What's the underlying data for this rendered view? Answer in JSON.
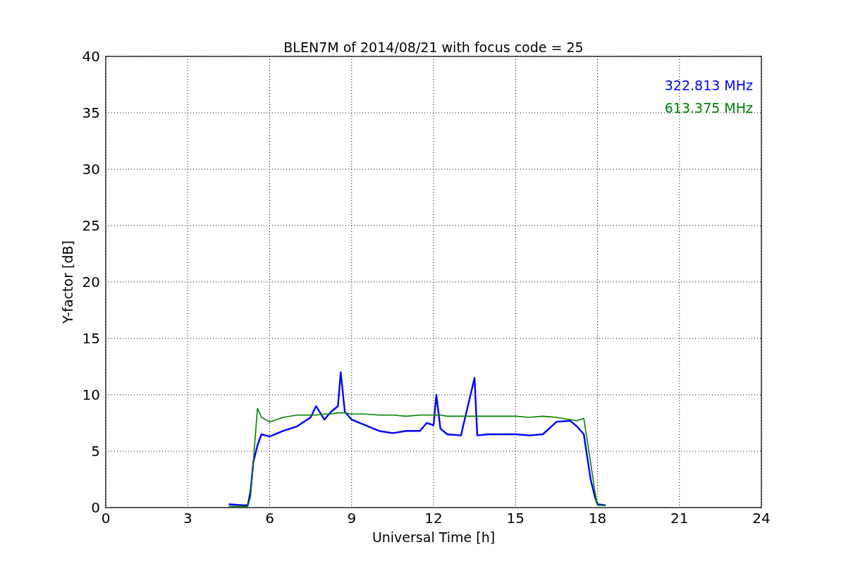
{
  "figure": {
    "chart_data": {
      "type": "line",
      "title": "BLEN7M of 2014/08/21 with focus code = 25",
      "xlabel": "Universal Time [h]",
      "ylabel": "Y-factor [dB]",
      "x": [
        4.5,
        5.0,
        5.2,
        5.3,
        5.4,
        5.55,
        5.7,
        6,
        6.5,
        7,
        7.5,
        7.7,
        8,
        8.25,
        8.5,
        8.6,
        8.75,
        9,
        9.5,
        10,
        10.5,
        11,
        11.5,
        11.75,
        12,
        12.1,
        12.25,
        12.5,
        13,
        13.5,
        13.6,
        14,
        14.5,
        15,
        15.5,
        16,
        16.5,
        17,
        17.25,
        17.5,
        17.75,
        17.9,
        18,
        18.3
      ],
      "series": [
        {
          "name": "322.813 MHz",
          "color": "#0000ff",
          "values": [
            0.3,
            0.2,
            0.2,
            1.5,
            4,
            5.5,
            6.5,
            6.3,
            6.8,
            7.2,
            8,
            9,
            7.8,
            8.5,
            9,
            12,
            8.5,
            7.8,
            7.3,
            6.8,
            6.6,
            6.8,
            6.8,
            7.5,
            7.3,
            10,
            7,
            6.5,
            6.4,
            11.5,
            6.4,
            6.5,
            6.5,
            6.5,
            6.4,
            6.5,
            7.6,
            7.7,
            7.2,
            6.5,
            2.5,
            1,
            0.3,
            0.2
          ]
        },
        {
          "name": "613.375 MHz",
          "color": "#008000",
          "values": [
            0.1,
            0.1,
            0.1,
            1,
            4,
            8.8,
            8,
            7.6,
            8,
            8.2,
            8.2,
            8.2,
            8.3,
            8.3,
            8.4,
            8.4,
            8.4,
            8.3,
            8.3,
            8.2,
            8.2,
            8.1,
            8.2,
            8.2,
            8.2,
            8.2,
            8.2,
            8.1,
            8.1,
            8.1,
            8.1,
            8.1,
            8.1,
            8.1,
            8,
            8.1,
            8,
            7.8,
            7.7,
            7.9,
            4,
            1.5,
            0.2,
            0.2
          ]
        }
      ],
      "grid": true,
      "xlim": [
        0,
        24
      ],
      "ylim": [
        0,
        40
      ],
      "xticks": [
        0,
        3,
        6,
        9,
        12,
        15,
        18,
        21,
        24
      ],
      "yticks": [
        0,
        5,
        10,
        15,
        20,
        25,
        30,
        35,
        40
      ]
    }
  }
}
